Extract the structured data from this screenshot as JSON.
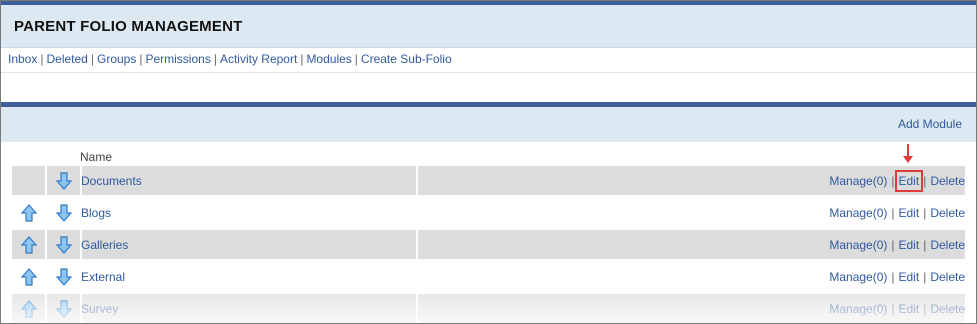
{
  "header": {
    "title": "PARENT FOLIO MANAGEMENT"
  },
  "nav": {
    "items": [
      "Inbox",
      "Deleted",
      "Groups",
      "Permissions",
      "Activity Report",
      "Modules",
      "Create Sub-Folio"
    ]
  },
  "toolbar": {
    "add_module_label": "Add Module"
  },
  "table": {
    "column_name": "Name",
    "rows": [
      {
        "name": "Documents",
        "manage": "Manage(0)",
        "edit": "Edit",
        "delete": "Delete"
      },
      {
        "name": "Blogs",
        "manage": "Manage(0)",
        "edit": "Edit",
        "delete": "Delete"
      },
      {
        "name": "Galleries",
        "manage": "Manage(0)",
        "edit": "Edit",
        "delete": "Delete"
      },
      {
        "name": "External",
        "manage": "Manage(0)",
        "edit": "Edit",
        "delete": "Delete"
      },
      {
        "name": "Survey",
        "manage": "Manage(0)",
        "edit": "Edit",
        "delete": "Delete"
      }
    ],
    "separator": "|"
  },
  "icons": {
    "up": "move-up-icon",
    "down": "move-down-icon",
    "annotation": "red-arrow-icon"
  },
  "colors": {
    "accent": "#3f5f9a",
    "link": "#2f5aa0",
    "header_bg": "#dce9f2",
    "highlight": "#e03a3a"
  }
}
